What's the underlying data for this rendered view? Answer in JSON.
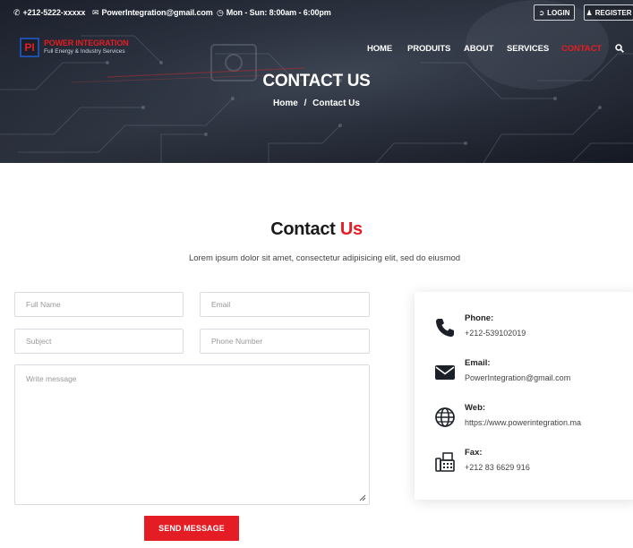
{
  "topbar": {
    "phone": "+212-5222-xxxxx",
    "email": "PowerIntegration@gmail.com",
    "hours": "Mon - Sun: 8:00am - 6:00pm",
    "login_label": "LOGIN",
    "register_label": "REGISTER"
  },
  "brand": {
    "mark": "PI",
    "title": "POWER INTEGRATION",
    "subtitle": "Full Energy & Industry Services"
  },
  "nav": {
    "items": [
      {
        "label": "HOME"
      },
      {
        "label": "PRODUITS"
      },
      {
        "label": "ABOUT"
      },
      {
        "label": "SERVICES"
      },
      {
        "label": "CONTACT"
      }
    ],
    "active": "CONTACT"
  },
  "hero": {
    "title": "CONTACT US",
    "breadcrumb_home": "Home",
    "breadcrumb_sep": "/",
    "breadcrumb_current": "Contact Us"
  },
  "section": {
    "title_main": "Contact",
    "title_accent": "Us",
    "subtitle": "Lorem ipsum dolor sit amet, consectetur adipisicing elit, sed do eiusmod"
  },
  "form": {
    "full_name_placeholder": "Full Name",
    "email_placeholder": "Email",
    "subject_placeholder": "Subject",
    "phone_placeholder": "Phone Number",
    "message_placeholder": "Write message",
    "submit_label": "SEND MESSAGE"
  },
  "contact_info": [
    {
      "icon": "phone-icon",
      "label": "Phone:",
      "value": "+212-539102019"
    },
    {
      "icon": "envelope-icon",
      "label": "Email:",
      "value": "PowerIntegration@gmail.com"
    },
    {
      "icon": "globe-icon",
      "label": "Web:",
      "value": "https://www.powerintegration.ma"
    },
    {
      "icon": "fax-icon",
      "label": "Fax:",
      "value": "+212 83 6629 916"
    }
  ],
  "colors": {
    "accent": "#e41c23",
    "brand_blue": "#1f4fa8",
    "hero_dark": "#151a24"
  }
}
